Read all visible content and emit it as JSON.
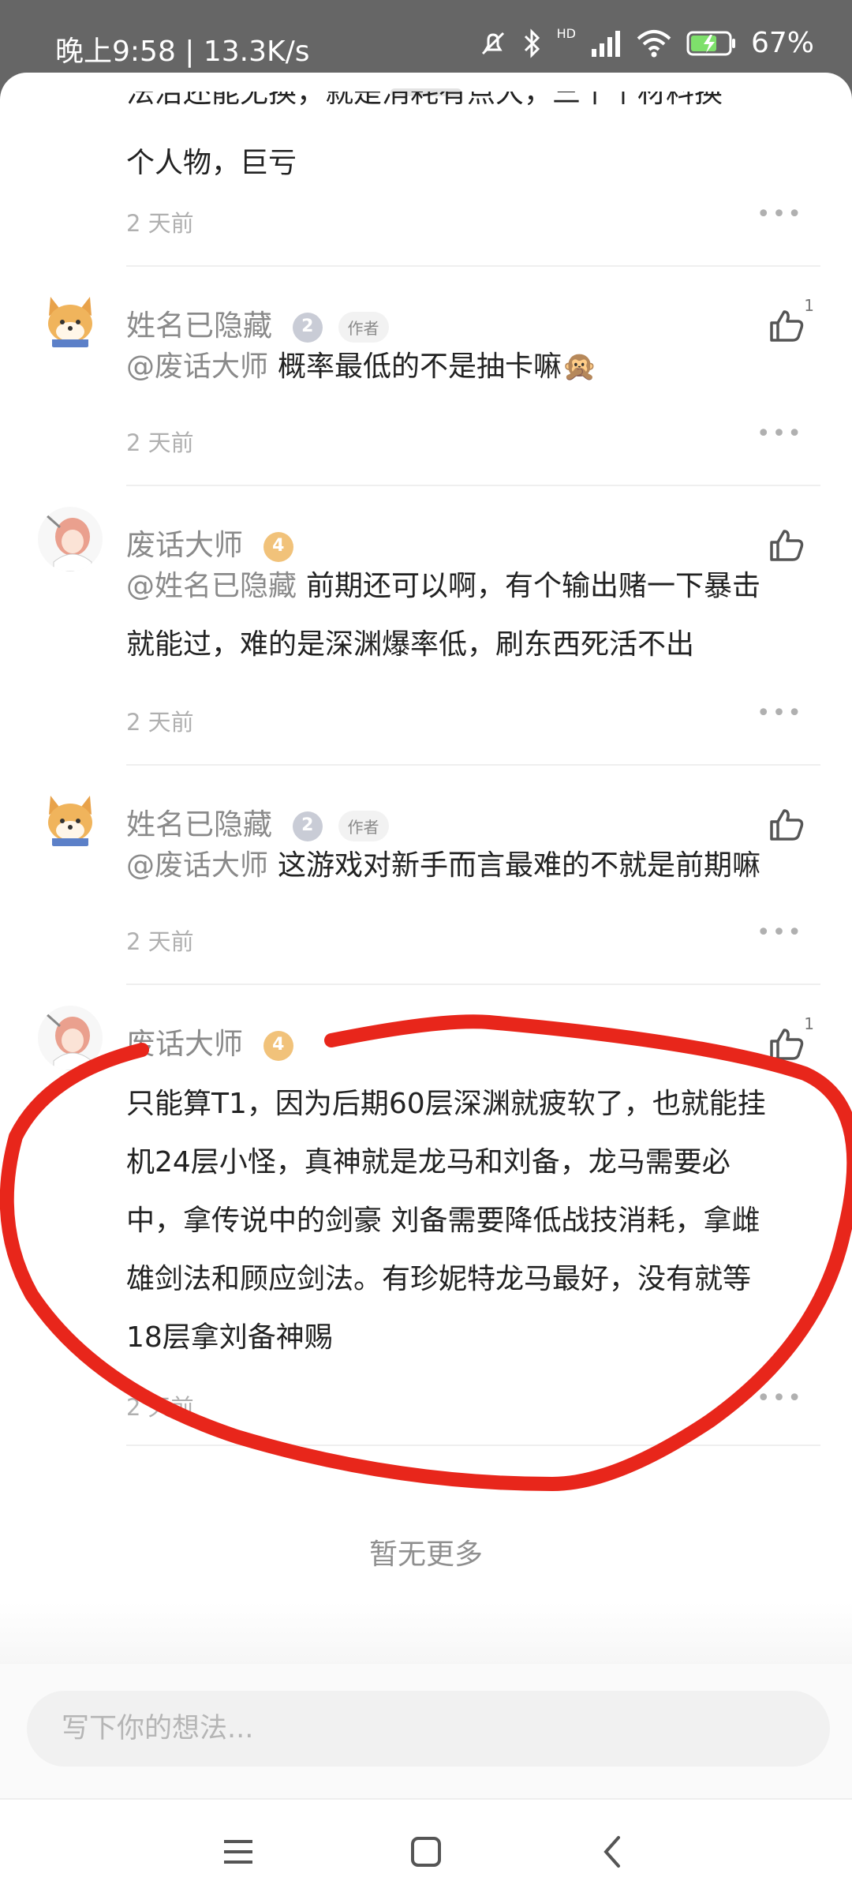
{
  "status_bar": {
    "time_speed": "晚上9:58 | 13.3K/s",
    "battery": "67%",
    "network": "HD"
  },
  "partial_comment": {
    "text_line_partial": "法治还能无换，就是消耗有点大，三十个材料换",
    "text_line": "个人物，巨亏",
    "time": "2 天前"
  },
  "comments": [
    {
      "user": "姓名已隐藏",
      "level": "2",
      "author_tag": "作者",
      "mention": "@废话大师",
      "text": "概率最低的不是抽卡嘛🙊",
      "time": "2 天前",
      "likes": "1"
    },
    {
      "user": "废话大师",
      "level": "4",
      "mention": "@姓名已隐藏",
      "text_line1": "前期还可以啊，有个输出赌一下暴击",
      "text_line2": "就能过，难的是深渊爆率低，刷东西死活不出",
      "time": "2 天前"
    },
    {
      "user": "姓名已隐藏",
      "level": "2",
      "author_tag": "作者",
      "mention": "@废话大师",
      "text": "这游戏对新手而言最难的不就是前期嘛",
      "time": "2 天前"
    },
    {
      "user": "废话大师",
      "level": "4",
      "likes": "1",
      "lines": [
        "只能算T1，因为后期60层深渊就疲软了，也就能挂",
        "机24层小怪，真神就是龙马和刘备，龙马需要必",
        "中，拿传说中的剑豪 刘备需要降低战技消耗，拿雌",
        "雄剑法和顾应剑法。有珍妮特龙马最好，没有就等",
        "18层拿刘备神赐"
      ],
      "time": "2 天前"
    }
  ],
  "footer": {
    "no_more": "暂无更多",
    "input_placeholder": "写下你的想法..."
  },
  "colors": {
    "annotation": "#e8261b",
    "badge_gold": "#f1c27a",
    "badge_silver": "#c9ccd6"
  }
}
